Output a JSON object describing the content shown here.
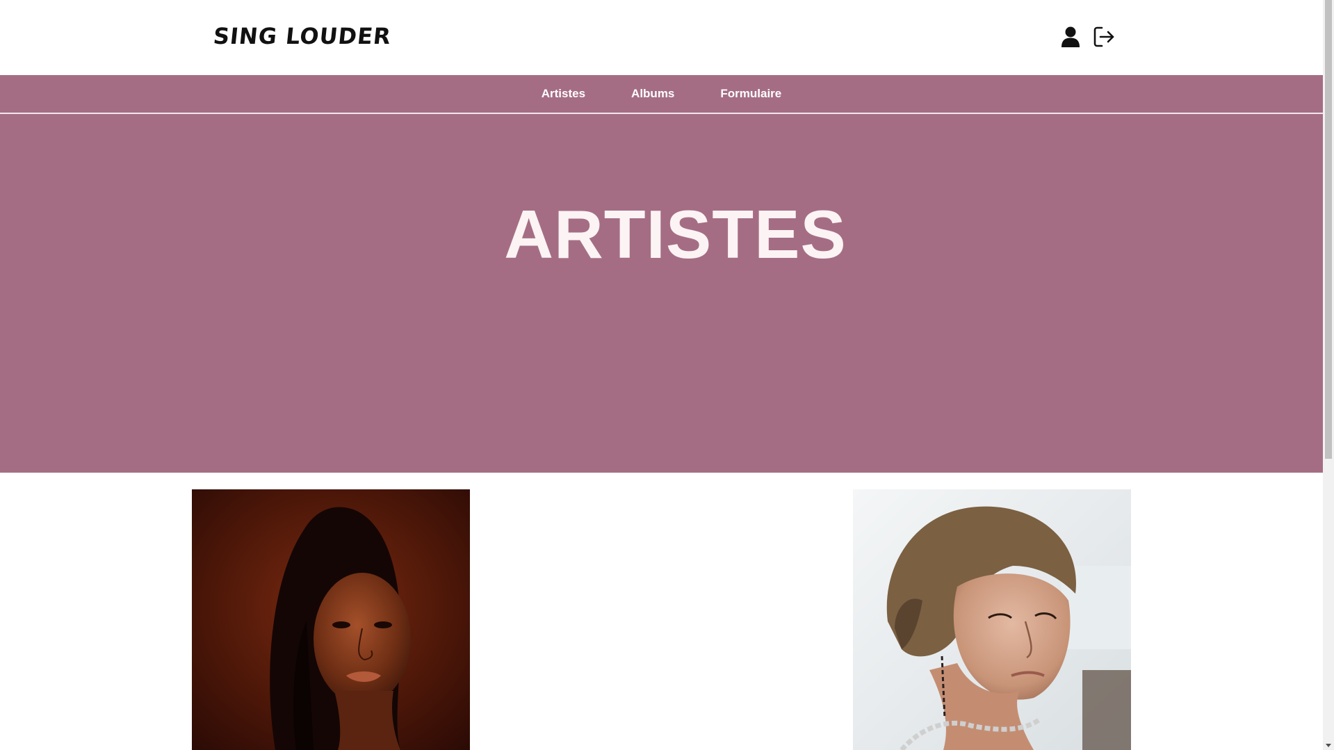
{
  "header": {
    "logo": "SING LOUDER",
    "icons": [
      "user-icon",
      "logout-icon"
    ]
  },
  "nav": {
    "items": [
      {
        "label": "Artistes"
      },
      {
        "label": "Albums"
      },
      {
        "label": "Formulaire"
      }
    ]
  },
  "hero": {
    "title": "ARTISTES"
  },
  "artists": [
    {
      "image": "artist-portrait-woman"
    },
    {
      "image": "artist-portrait-man"
    }
  ],
  "colors": {
    "brand": "#a56d84",
    "hero_text": "#fbf3f4",
    "nav_text": "#ffffff"
  }
}
